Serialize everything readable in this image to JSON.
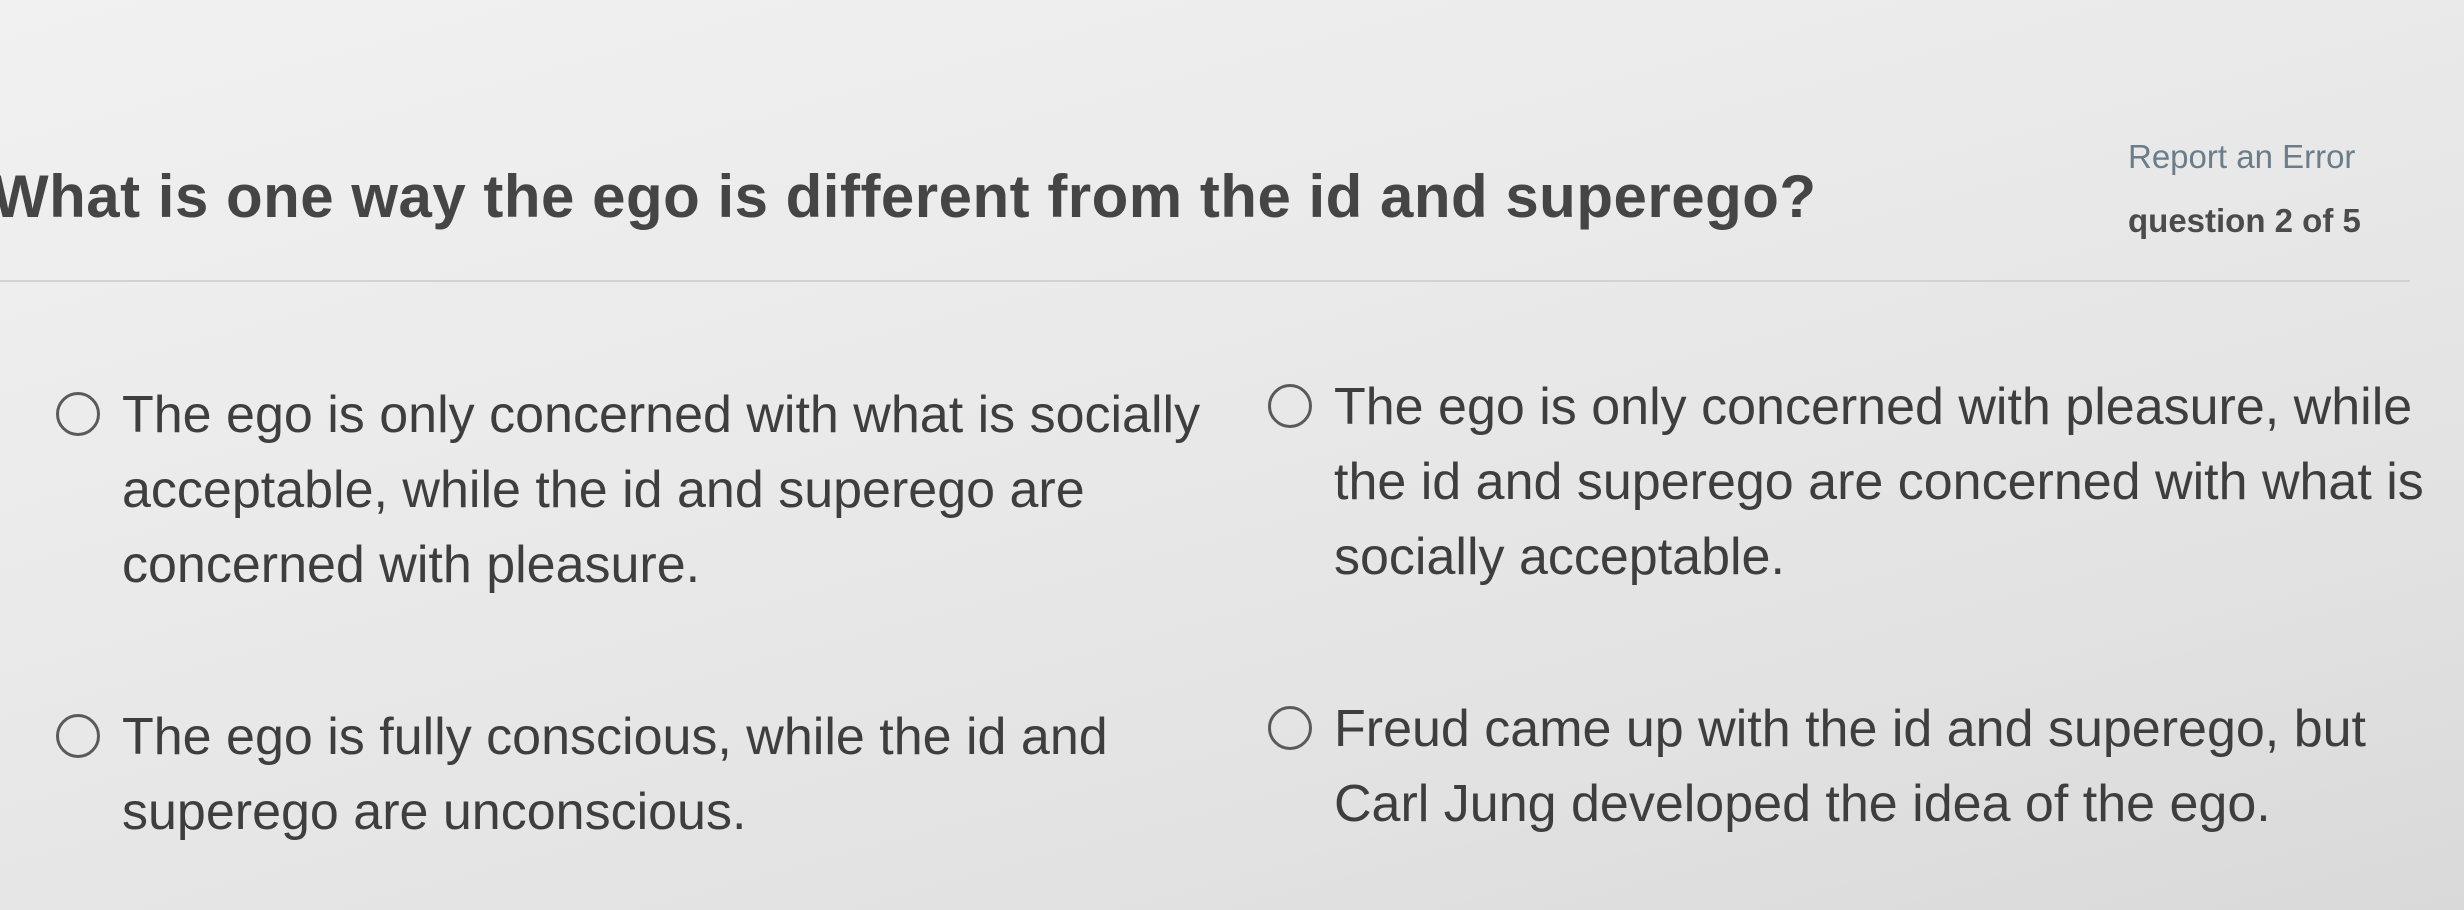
{
  "question": {
    "text": "What is one way the ego is different from the id and superego?"
  },
  "header": {
    "report_label": "Report an Error",
    "counter_label": "question 2 of 5"
  },
  "options": [
    {
      "text": "The ego is only concerned with what is socially acceptable, while the id and superego are concerned with pleasure.",
      "selected": false
    },
    {
      "text": "The ego is only concerned with pleasure, while the id and superego are concerned with what is socially acceptable.",
      "selected": false
    },
    {
      "text": "The ego is fully conscious, while the id and superego are unconscious.",
      "selected": false
    },
    {
      "text": "Freud came up with the id and superego, but Carl Jung developed the idea of the ego.",
      "selected": false
    }
  ]
}
